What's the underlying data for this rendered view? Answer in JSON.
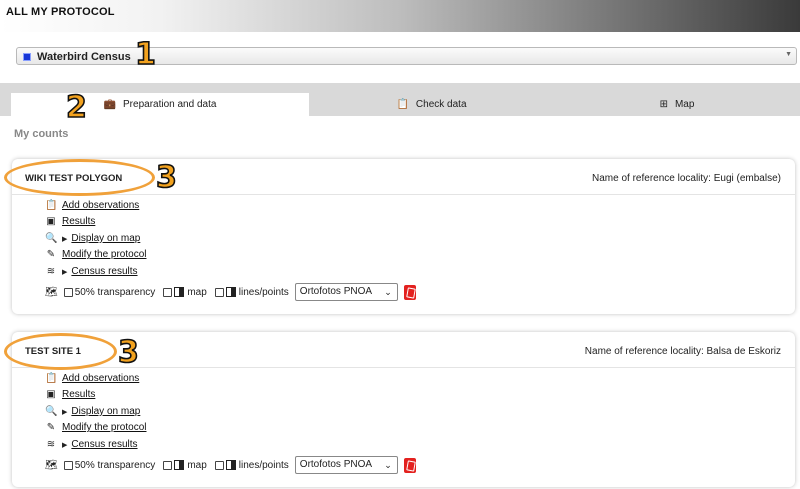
{
  "header": {
    "title": "ALL MY PROTOCOL"
  },
  "protocol_select": {
    "value": "Waterbird Census"
  },
  "tabs": [
    {
      "label": "Preparation and data",
      "icon": "briefcase-icon",
      "active": true
    },
    {
      "label": "Check data",
      "icon": "clipboard-icon",
      "active": false
    },
    {
      "label": "Map",
      "icon": "grid-icon",
      "active": false
    }
  ],
  "section_title": "My counts",
  "annotations": {
    "one": "1",
    "two": "2",
    "three": "3"
  },
  "cards": [
    {
      "name": "WIKI TEST POLYGON",
      "reference": "Name of reference locality: Eugi (embalse)",
      "actions": {
        "add": "Add observations",
        "results": "Results",
        "display": "Display on map",
        "modify": "Modify the protocol",
        "census": "Census results"
      },
      "tools": {
        "transparency": "50% transparency",
        "map": "map",
        "lines": "lines/points",
        "basemap": "Ortofotos PNOA"
      }
    },
    {
      "name": "TEST SITE 1",
      "reference": "Name of reference locality: Balsa de Eskoriz",
      "actions": {
        "add": "Add observations",
        "results": "Results",
        "display": "Display on map",
        "modify": "Modify the protocol",
        "census": "Census results"
      },
      "tools": {
        "transparency": "50% transparency",
        "map": "map",
        "lines": "lines/points",
        "basemap": "Ortofotos PNOA"
      }
    }
  ],
  "colors": {
    "annotation": "#f2a21f",
    "pdf": "#e3211f",
    "protocol_marker": "#1736d6"
  }
}
